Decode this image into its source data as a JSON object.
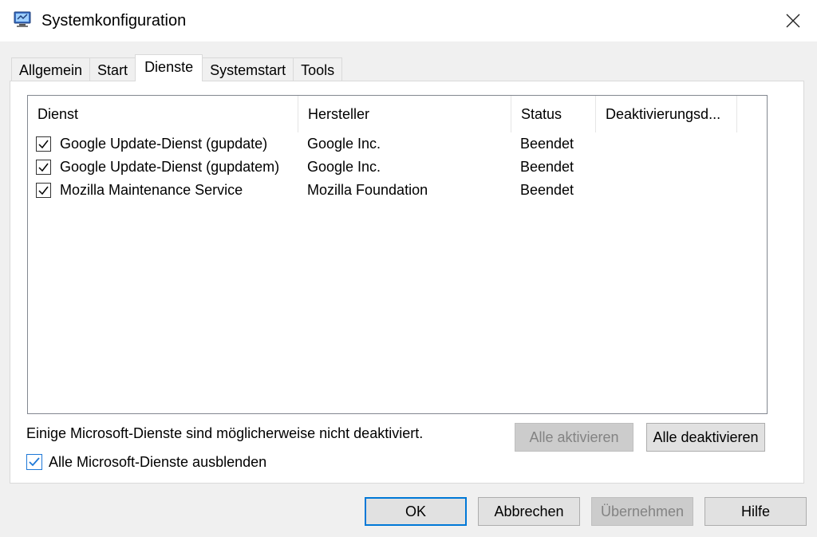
{
  "window": {
    "title": "Systemkonfiguration",
    "icon": "msconfig-icon"
  },
  "tabs": [
    {
      "label": "Allgemein",
      "active": false
    },
    {
      "label": "Start",
      "active": false
    },
    {
      "label": "Dienste",
      "active": true
    },
    {
      "label": "Systemstart",
      "active": false
    },
    {
      "label": "Tools",
      "active": false
    }
  ],
  "services": {
    "columns": [
      "Dienst",
      "Hersteller",
      "Status",
      "Deaktivierungsd..."
    ],
    "rows": [
      {
        "checked": true,
        "name": "Google Update-Dienst (gupdate)",
        "vendor": "Google Inc.",
        "status": "Beendet",
        "disabled_date": ""
      },
      {
        "checked": true,
        "name": "Google Update-Dienst (gupdatem)",
        "vendor": "Google Inc.",
        "status": "Beendet",
        "disabled_date": ""
      },
      {
        "checked": true,
        "name": "Mozilla Maintenance Service",
        "vendor": "Mozilla Foundation",
        "status": "Beendet",
        "disabled_date": ""
      }
    ]
  },
  "note": "Einige Microsoft-Dienste sind möglicherweise nicht deaktiviert.",
  "hide_ms": {
    "label": "Alle Microsoft-Dienste ausblenden",
    "checked": true
  },
  "buttons": {
    "enable_all": "Alle aktivieren",
    "disable_all": "Alle deaktivieren",
    "ok": "OK",
    "cancel": "Abbrechen",
    "apply": "Übernehmen",
    "help": "Hilfe"
  },
  "colors": {
    "accent": "#0078d7",
    "disabled_text": "#838383"
  }
}
